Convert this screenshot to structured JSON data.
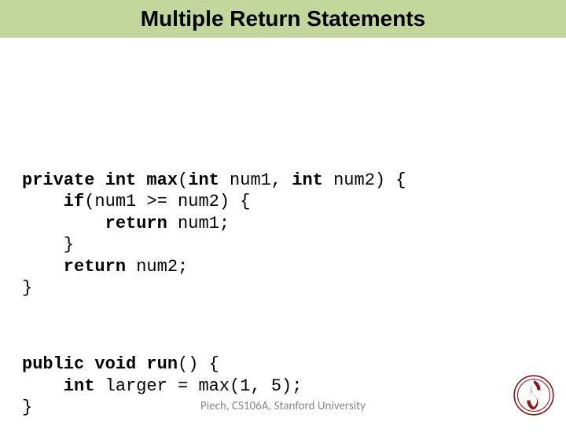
{
  "title": "Multiple Return Statements",
  "code": {
    "b1": {
      "l1a": "private int max",
      "l1b": "(",
      "l1c": "int",
      "l1d": " num1, ",
      "l1e": "int",
      "l1f": " num2) {",
      "l2a": "    if",
      "l2b": "(num1 >= num2) {",
      "l3a": "        return",
      "l3b": " num1;",
      "l4": "    }",
      "l5a": "    return",
      "l5b": " num2;",
      "l6": "}"
    },
    "b2": {
      "l1a": "public void run",
      "l1b": "() {",
      "l2a": "    int",
      "l2b": " larger = max(1, 5);",
      "l3": "}"
    }
  },
  "footer": "Piech, CS106A, Stanford University",
  "logo_name": "stanford-seal"
}
